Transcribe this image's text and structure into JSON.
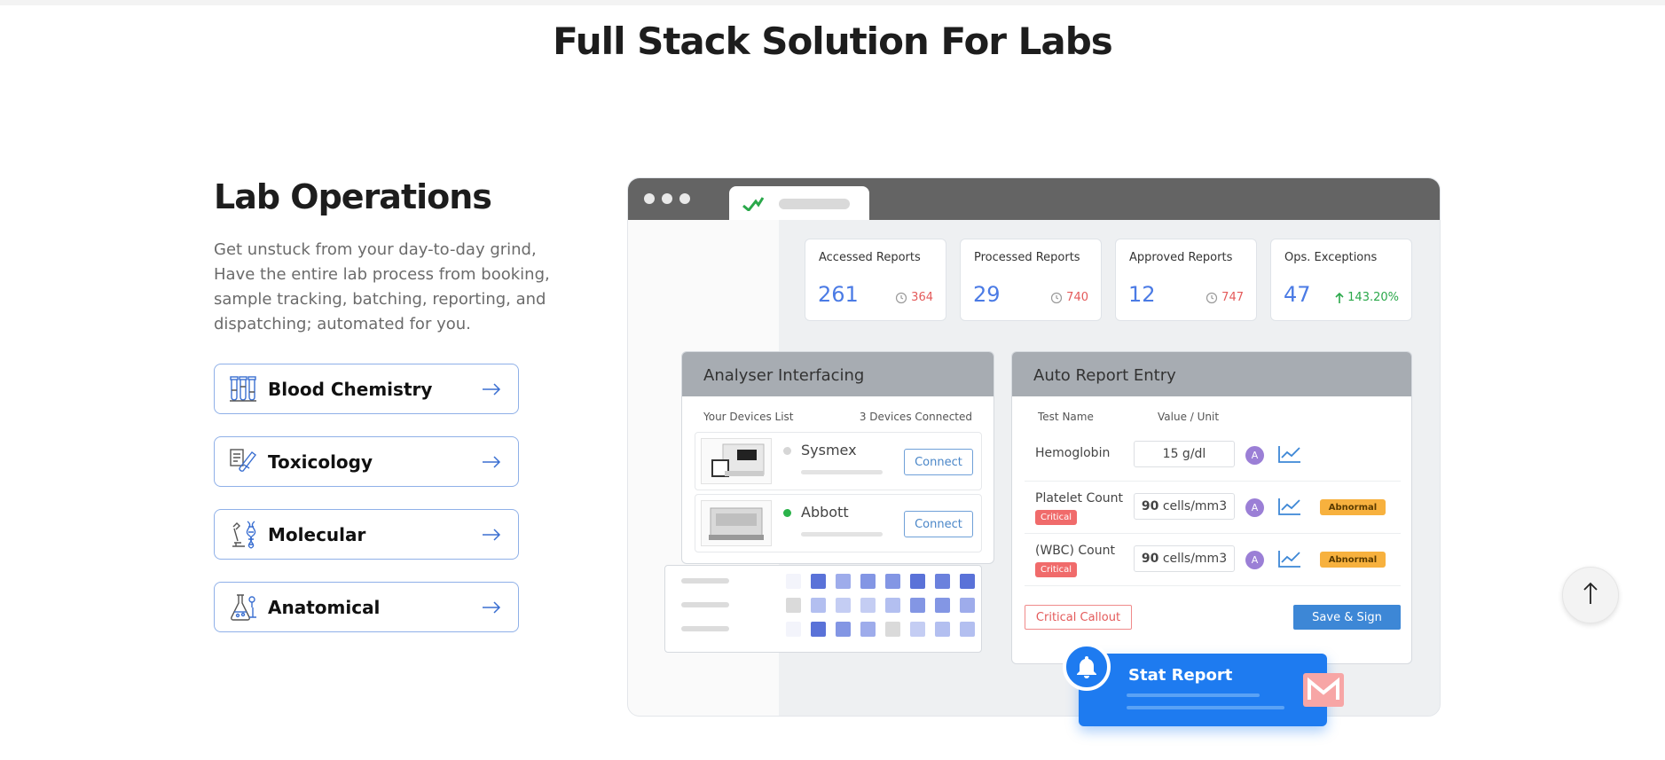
{
  "page": {
    "title": "Full Stack Solution For Labs"
  },
  "section": {
    "title": "Lab Operations",
    "description": "Get unstuck from your day-to-day grind, Have the entire lab process from booking, sample tracking, batching, reporting, and dispatching; automated for you."
  },
  "categories": [
    {
      "label": "Blood Chemistry",
      "icon": "test-tubes-icon"
    },
    {
      "label": "Toxicology",
      "icon": "test-tube-clipboard-icon"
    },
    {
      "label": "Molecular",
      "icon": "dna-microscope-icon"
    },
    {
      "label": "Anatomical",
      "icon": "flask-icon"
    }
  ],
  "dashboard": {
    "kpis": [
      {
        "title": "Accessed Reports",
        "value": "261",
        "sub": "364"
      },
      {
        "title": "Processed Reports",
        "value": "29",
        "sub": "740"
      },
      {
        "title": "Approved Reports",
        "value": "12",
        "sub": "747"
      },
      {
        "title": "Ops. Exceptions",
        "value": "47",
        "sub": "143.20%"
      }
    ],
    "analyser": {
      "title": "Analyser Interfacing",
      "list_label": "Your Devices List",
      "connected": "3 Devices Connected",
      "devices": [
        {
          "name": "Sysmex",
          "status_color": "#d6d6d6",
          "button": "Connect"
        },
        {
          "name": "Abbott",
          "status_color": "#2bb34a",
          "button": "Connect"
        }
      ]
    },
    "auto_report": {
      "title": "Auto Report Entry",
      "col_test": "Test Name",
      "col_value": "Value / Unit",
      "rows": [
        {
          "name": "Hemoglobin",
          "value": "15 g/dl",
          "critical": "",
          "flag": ""
        },
        {
          "name": "Platelet Count",
          "value_num": "90",
          "value_unit": "cells/mm3",
          "critical": "Critical",
          "flag": "Abnormal"
        },
        {
          "name": "(WBC) Count",
          "value_num": "90",
          "value_unit": "cells/mm3",
          "critical": "Critical",
          "flag": "Abnormal"
        }
      ],
      "avatar": "A",
      "critical_callout": "Critical Callout",
      "save_sign": "Save & Sign"
    },
    "stat_report": "Stat Report"
  },
  "colors": {
    "accent": "#4b7be5",
    "stat_blue": "#1e7bf0",
    "save_blue": "#3d87d6"
  }
}
